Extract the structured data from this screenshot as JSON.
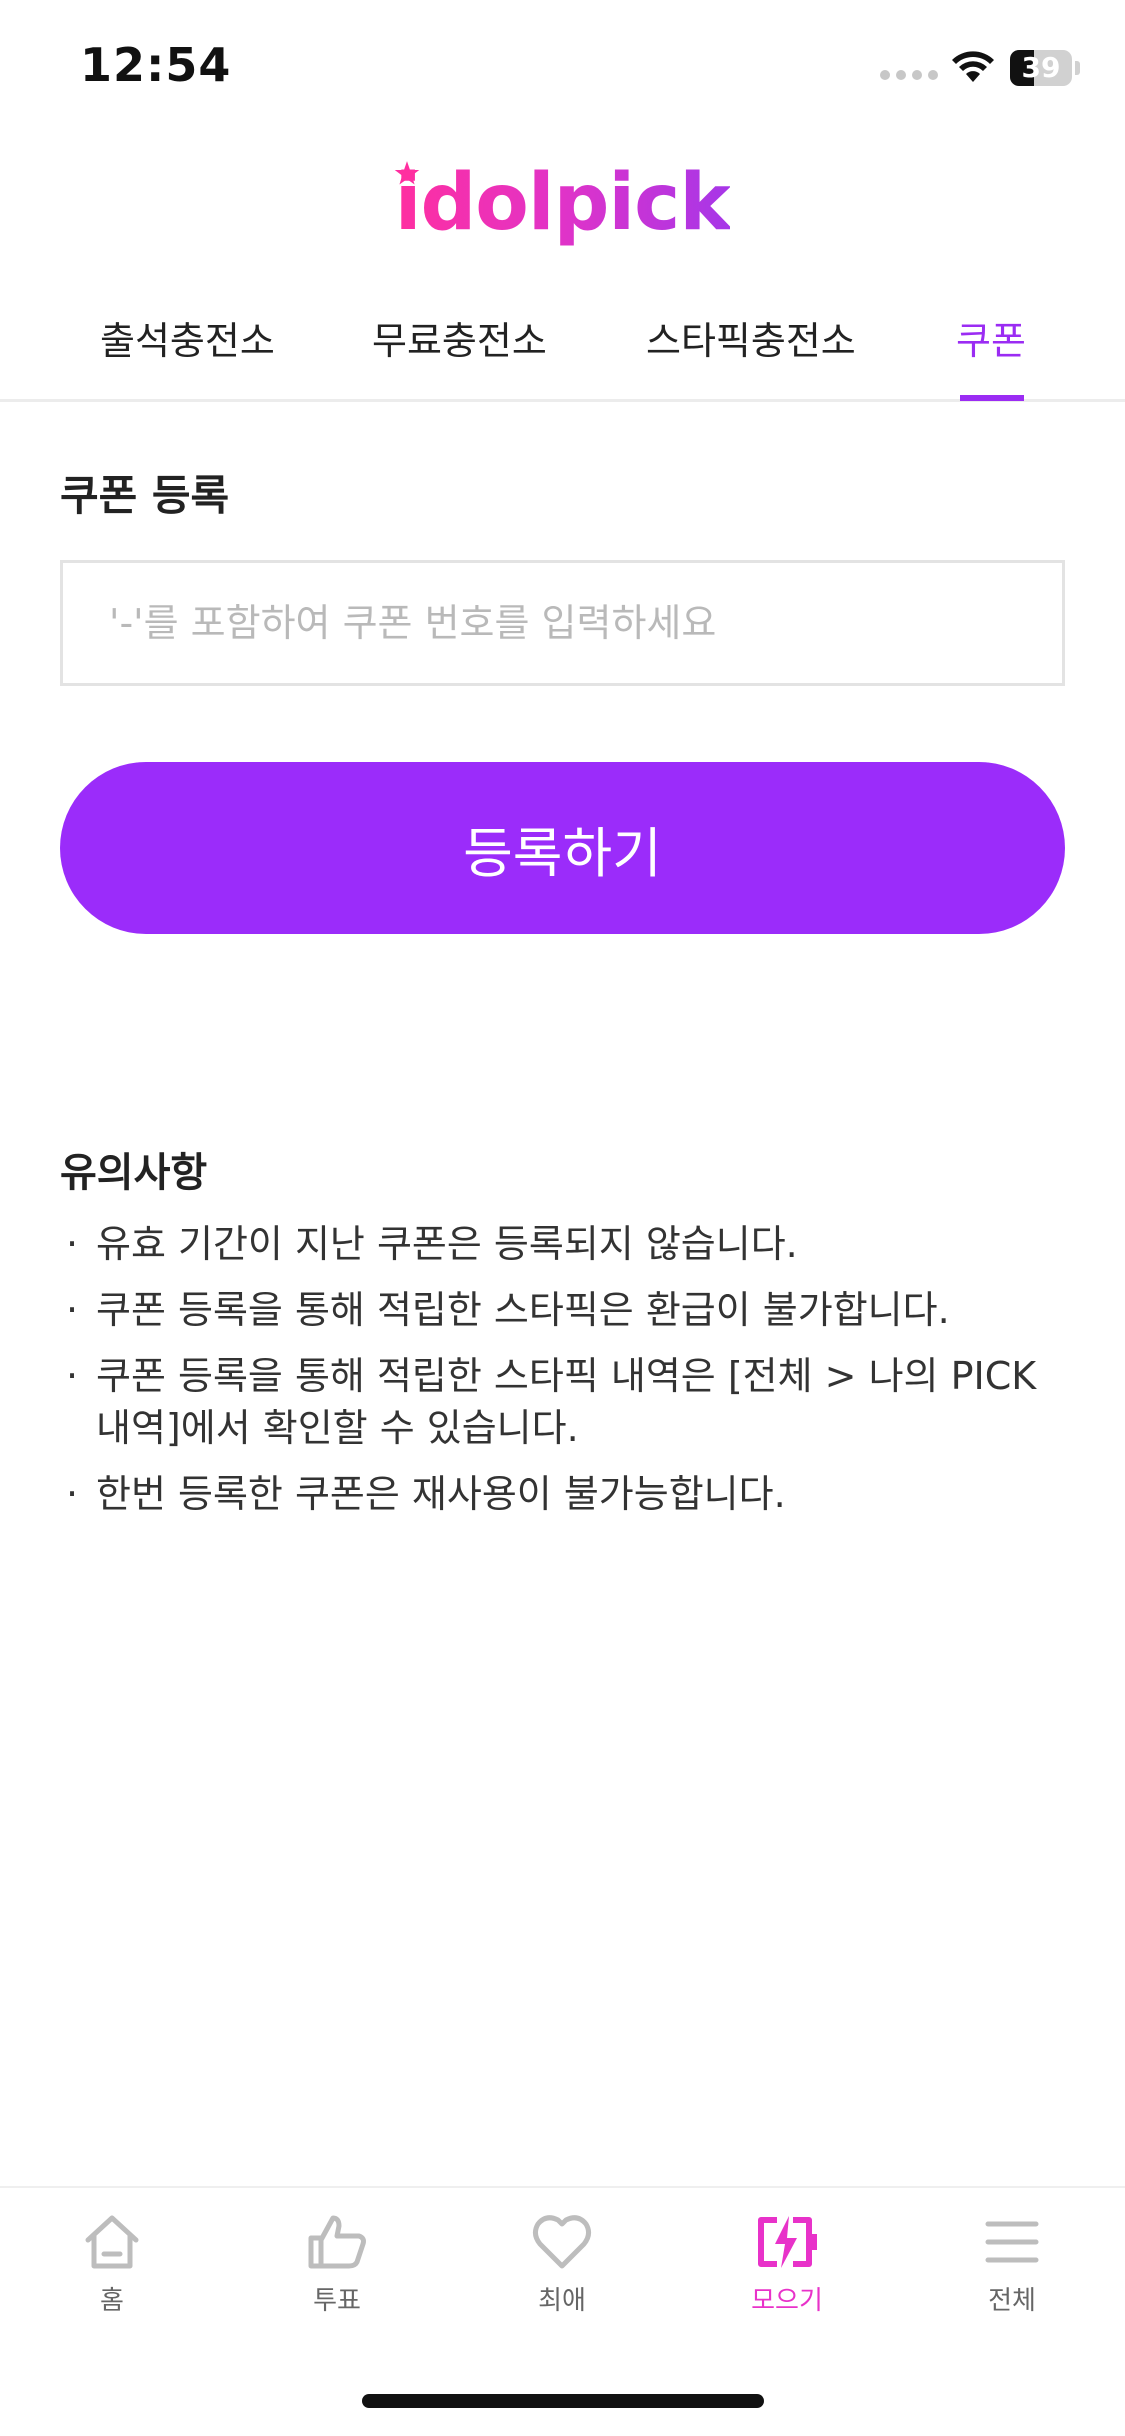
{
  "status_bar": {
    "time": "12:54",
    "battery_level": 39,
    "battery_label": "39"
  },
  "logo": {
    "text": "idolpick"
  },
  "tabs": [
    {
      "label": "출석충전소"
    },
    {
      "label": "무료충전소"
    },
    {
      "label": "스타픽충전소"
    },
    {
      "label": "쿠폰",
      "active": true
    }
  ],
  "coupon": {
    "title": "쿠폰 등록",
    "input_value": "",
    "input_placeholder": "'-'를 포함하여 쿠폰 번호를 입력하세요",
    "register_label": "등록하기"
  },
  "notice": {
    "title": "유의사항",
    "items": [
      "유효 기간이 지난 쿠폰은 등록되지 않습니다.",
      "쿠폰 등록을 통해 적립한 스타픽은 환급이 불가합니다.",
      "쿠폰 등록을 통해 적립한 스타픽 내역은 [전체 > 나의 PICK 내역]에서 확인할 수 있습니다.",
      "한번 등록한 쿠폰은 재사용이 불가능합니다."
    ]
  },
  "bottom_nav": [
    {
      "label": "홈",
      "icon": "home-icon"
    },
    {
      "label": "투표",
      "icon": "thumbs-up-icon"
    },
    {
      "label": "최애",
      "icon": "heart-icon"
    },
    {
      "label": "모으기",
      "icon": "charge-icon",
      "active": true
    },
    {
      "label": "전체",
      "icon": "menu-icon"
    }
  ],
  "colors": {
    "accent": "#9b2cf3",
    "button": "#9b2cfa",
    "nav_active": "#e832c9",
    "logo_gradient_start": "#ff2fa0",
    "logo_gradient_end": "#a636e8"
  }
}
